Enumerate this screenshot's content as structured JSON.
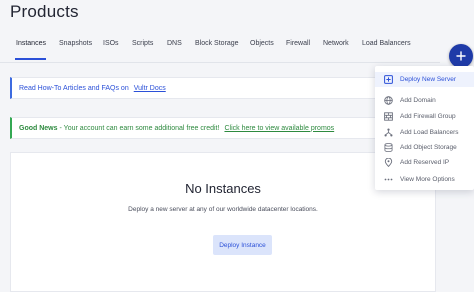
{
  "page": {
    "title": "Products"
  },
  "tabs": [
    {
      "label": "Instances",
      "active": true
    },
    {
      "label": "Snapshots"
    },
    {
      "label": "ISOs"
    },
    {
      "label": "Scripts"
    },
    {
      "label": "DNS"
    },
    {
      "label": "Block Storage"
    },
    {
      "label": "Objects"
    },
    {
      "label": "Firewall"
    },
    {
      "label": "Network"
    },
    {
      "label": "Load Balancers"
    }
  ],
  "fab": {
    "icon": "plus-icon",
    "color": "#1f3ba8"
  },
  "notices": {
    "info": {
      "prefix": "Read How-To Articles and FAQs on",
      "link": "Vultr Docs",
      "accent": "#3d6be0"
    },
    "promo": {
      "label": "Good News",
      "text": "- Your account can earn some additional free credit!",
      "link": "Click here to view available promos",
      "accent": "#34a853"
    }
  },
  "empty_state": {
    "title": "No Instances",
    "subtitle": "Deploy a new server at any of our worldwide datacenter locations.",
    "button": "Deploy Instance"
  },
  "menu": {
    "items": [
      {
        "label": "Deploy New Server",
        "icon": "server-plus-icon",
        "active": true
      },
      {
        "label": "Add Domain",
        "icon": "globe-icon"
      },
      {
        "label": "Add Firewall Group",
        "icon": "firewall-icon"
      },
      {
        "label": "Add Load Balancers",
        "icon": "load-balancer-icon"
      },
      {
        "label": "Add Object Storage",
        "icon": "object-storage-icon"
      },
      {
        "label": "Add Reserved IP",
        "icon": "reserved-ip-icon"
      },
      {
        "label": "View More Options",
        "icon": "more-icon"
      }
    ]
  }
}
